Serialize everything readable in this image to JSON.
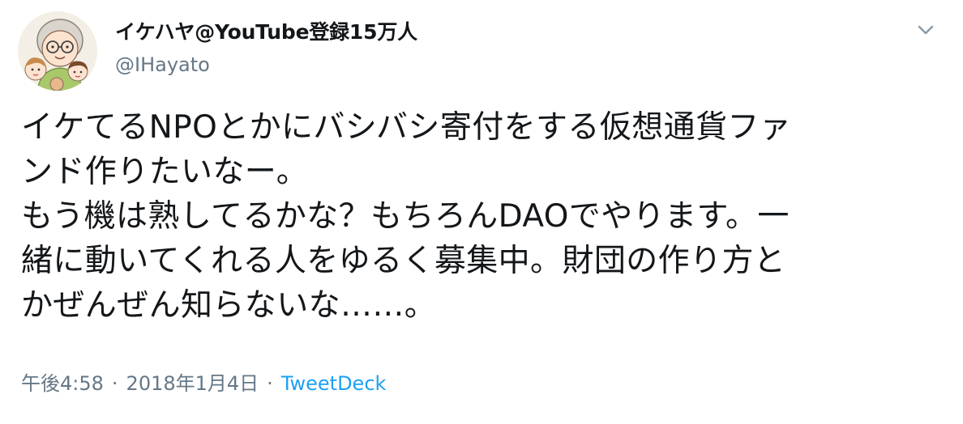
{
  "author": {
    "display_name": "イケハヤ@YouTube登録15万人",
    "screen_name": "@IHayato",
    "avatar_icon": "cartoon-family-avatar"
  },
  "menu": {
    "icon": "chevron-down-icon"
  },
  "tweet": {
    "lines": [
      "イケてるNPOとかにバシバシ寄付をする仮想通貨ファ",
      "ンド作りたいなー。",
      "もう機は熟してるかな？もちろんDAOでやります。一",
      "緒に動いてくれる人をゆるく募集中。財団の作り方と",
      "かぜんぜん知らないな……。"
    ]
  },
  "meta": {
    "time": "午後4:58",
    "separator1": "·",
    "date": "2018年1月4日",
    "separator2": "·",
    "source": "TweetDeck"
  },
  "colors": {
    "text": "#14171a",
    "secondary": "#657786",
    "link": "#1da1f2"
  }
}
